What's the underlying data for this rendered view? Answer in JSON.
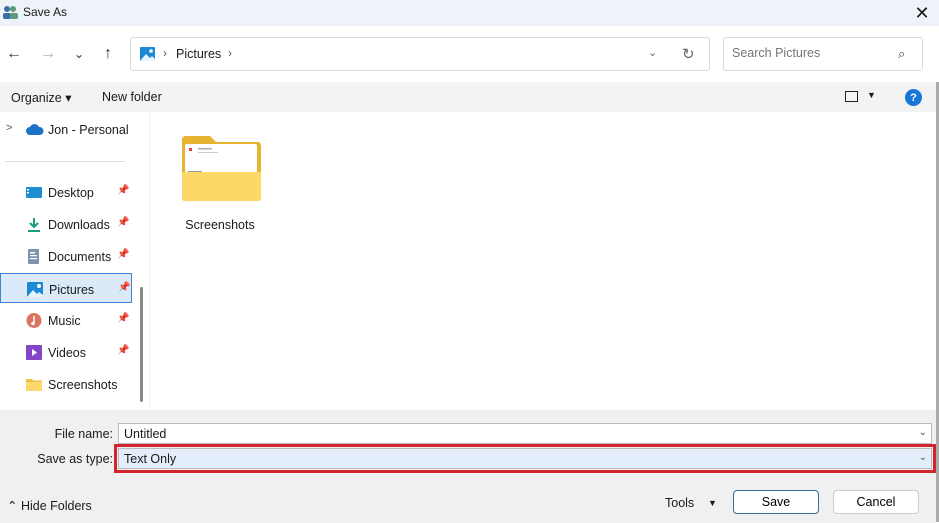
{
  "window": {
    "title": "Save As",
    "close_glyph": "✕"
  },
  "nav": {
    "back_glyph": "←",
    "forward_glyph": "→",
    "recent_glyph": "⌄",
    "up_glyph": "↑",
    "breadcrumb": [
      {
        "label": "Pictures"
      }
    ],
    "sep_glyph": "›",
    "dropdown_glyph": "⌄",
    "refresh_glyph": "↻",
    "search_placeholder": "Search Pictures",
    "search_glyph": "⌕"
  },
  "commands": {
    "organize": "Organize ▾",
    "new_folder": "New folder",
    "view_dd": "▼",
    "help": "?"
  },
  "sidebar": {
    "cloud": {
      "label": "Jon - Personal",
      "expand_glyph": ">"
    },
    "items": [
      {
        "label": "Desktop",
        "pinned": true
      },
      {
        "label": "Downloads",
        "pinned": true
      },
      {
        "label": "Documents",
        "pinned": true
      },
      {
        "label": "Pictures",
        "pinned": true,
        "selected": true
      },
      {
        "label": "Music",
        "pinned": true
      },
      {
        "label": "Videos",
        "pinned": true
      },
      {
        "label": "Screenshots",
        "pinned": false
      }
    ],
    "pin_glyph": "📌"
  },
  "content": {
    "items": [
      {
        "label": "Screenshots",
        "type": "folder"
      }
    ]
  },
  "form": {
    "file_name_label": "File name:",
    "file_name_value": "Untitled",
    "save_type_label": "Save as type:",
    "save_type_value": "Text Only",
    "chevron": "⌄",
    "highlight_color": "#d3232c"
  },
  "footer": {
    "hide_folders": "⌃  Hide Folders",
    "tools": "Tools",
    "tools_dd": "▼",
    "save": "Save",
    "cancel": "Cancel"
  }
}
